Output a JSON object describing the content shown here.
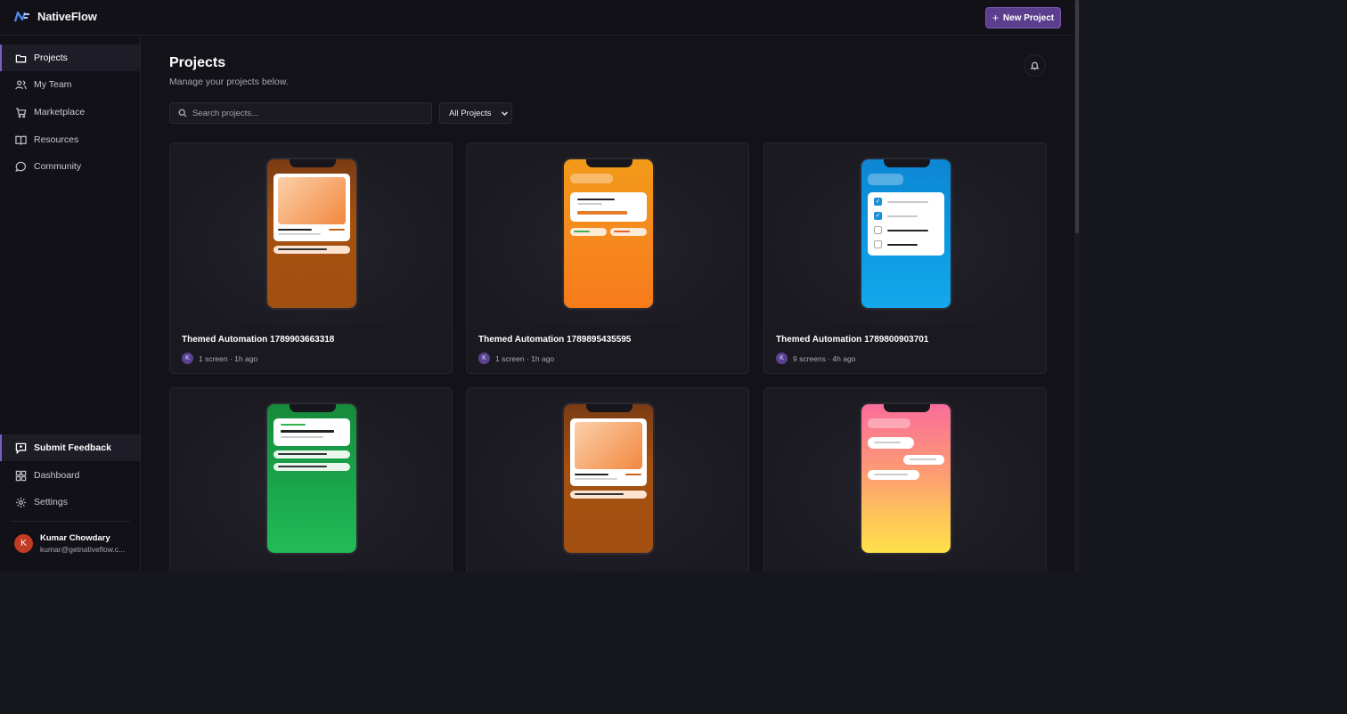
{
  "app": {
    "name": "NativeFlow"
  },
  "header": {
    "new_project_label": "New Project"
  },
  "sidebar": {
    "items": [
      {
        "label": "Projects",
        "icon": "folder-icon",
        "active": true
      },
      {
        "label": "My Team",
        "icon": "users-icon"
      },
      {
        "label": "Marketplace",
        "icon": "cart-icon"
      },
      {
        "label": "Resources",
        "icon": "book-icon"
      },
      {
        "label": "Community",
        "icon": "chat-icon"
      }
    ],
    "bottom_items": [
      {
        "label": "Submit Feedback",
        "icon": "feedback-icon"
      },
      {
        "label": "Dashboard",
        "icon": "grid-icon"
      },
      {
        "label": "Settings",
        "icon": "gear-icon"
      }
    ],
    "user": {
      "initial": "K",
      "name": "Kumar Chowdary",
      "email": "kumar@getnativeflow.c..."
    }
  },
  "main": {
    "title": "Projects",
    "subtitle": "Manage your projects below.",
    "search": {
      "placeholder": "Search projects..."
    },
    "filter": {
      "selected": "All Projects"
    }
  },
  "projects": [
    {
      "title": "Themed Automation 1789903663318",
      "meta": "1 screen · 1h ago",
      "owner_initial": "K",
      "theme": "brown"
    },
    {
      "title": "Themed Automation 1789895435595",
      "meta": "1 screen · 1h ago",
      "owner_initial": "K",
      "theme": "orange"
    },
    {
      "title": "Themed Automation 1789800903701",
      "meta": "9 screens · 4h ago",
      "owner_initial": "K",
      "theme": "blue"
    },
    {
      "title": "",
      "meta": "",
      "owner_initial": "",
      "theme": "green"
    },
    {
      "title": "",
      "meta": "",
      "owner_initial": "",
      "theme": "brown"
    },
    {
      "title": "",
      "meta": "",
      "owner_initial": "",
      "theme": "pink-yellow"
    }
  ],
  "colors": {
    "accent": "#5b3f8e",
    "avatar": "#c23b25",
    "background": "#131219"
  }
}
